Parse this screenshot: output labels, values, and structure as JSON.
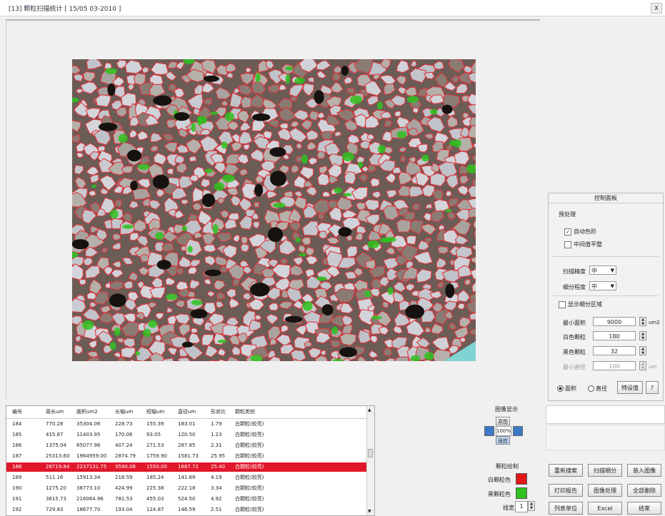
{
  "window": {
    "title": "[13] 颗粒扫描统计 [ 15/05 03-2010 ]",
    "close_label": "X"
  },
  "colors": {
    "boundary": "#e0363f",
    "pore_green": "#2fc21f",
    "highlight_row": "#e0182a",
    "accent_blue": "#3c78c8"
  },
  "control_panel": {
    "title": "控制面板",
    "preprocess_label": "预处理",
    "auto_color_label": "自动色阶",
    "median_filter_label": "中间值平整",
    "scan_precision_label": "扫描精度",
    "scan_precision_value": "中",
    "subdiv_precision_label": "细分程度",
    "subdiv_precision_value": "中",
    "show_subdiv_label": "显示细分区域",
    "min_area_label": "最小面积",
    "min_area_value": "9000",
    "min_area_unit": "um2",
    "white_particle_label": "白色颗粒",
    "white_particle_value": "180",
    "black_particle_label": "黑色颗粒",
    "black_particle_value": "32",
    "min_diam_label": "最小直径",
    "min_diam_value": "100",
    "min_diam_unit": "um",
    "radio_area_label": "面积",
    "radio_diam_label": "直径",
    "special_button": "特设值",
    "help_button": "?"
  },
  "image_display": {
    "title": "图像显示",
    "btn_orig": "原图",
    "zoom": "100%",
    "btn_fit": "适应"
  },
  "particle_draw": {
    "title": "颗粒绘制",
    "white_label": "白颗粒色",
    "black_label": "黑颗粒色",
    "line_label": "线宽",
    "line_value": "1"
  },
  "buttons": {
    "rescan": "重新搜索",
    "scan_subdiv": "扫描细分",
    "load_image": "装入图像",
    "print_report": "打印报告",
    "image_proc": "图像处理",
    "delete_all": "全部删除",
    "list_units": "列表单位",
    "excel": "Excel",
    "finish": "结束"
  },
  "table": {
    "headers": [
      "编号",
      "周长um",
      "面积um2",
      "长轴um",
      "短轴um",
      "直径um",
      "形状比",
      "颗粒类别"
    ],
    "rows": [
      [
        "184",
        "770.28",
        "35304.06",
        "228.73",
        "155.39",
        "183.01",
        "1.79",
        "白颗粒(较亮)"
      ],
      [
        "185",
        "415.87",
        "11403.95",
        "170.06",
        "93.05",
        "120.50",
        "1.23",
        "白颗粒(较亮)"
      ],
      [
        "186",
        "1375.04",
        "85077.96",
        "407.24",
        "271.53",
        "287.85",
        "2.31",
        "白颗粒(较亮)"
      ],
      [
        "187",
        "25313.60",
        "1964959.00",
        "2874.79",
        "1759.90",
        "1581.73",
        "25.95",
        "白颗粒(较亮)"
      ],
      [
        "188",
        "28719.84",
        "2237131.75",
        "3590.06",
        "1550.00",
        "1687.72",
        "25.40",
        "白颗粒(较亮)"
      ],
      [
        "189",
        "511.16",
        "15913.34",
        "218.59",
        "185.24",
        "141.69",
        "4.19",
        "白颗粒(较亮)"
      ],
      [
        "190",
        "1275.20",
        "38773.10",
        "424.99",
        "225.38",
        "222.18",
        "3.34",
        "白颗粒(较亮)"
      ],
      [
        "191",
        "3615.73",
        "216064.96",
        "781.53",
        "455.03",
        "524.50",
        "4.92",
        "白颗粒(较亮)"
      ],
      [
        "192",
        "729.83",
        "18677.70",
        "193.04",
        "124.87",
        "146.59",
        "2.51",
        "白颗粒(较亮)"
      ]
    ],
    "highlight_index": 4
  }
}
